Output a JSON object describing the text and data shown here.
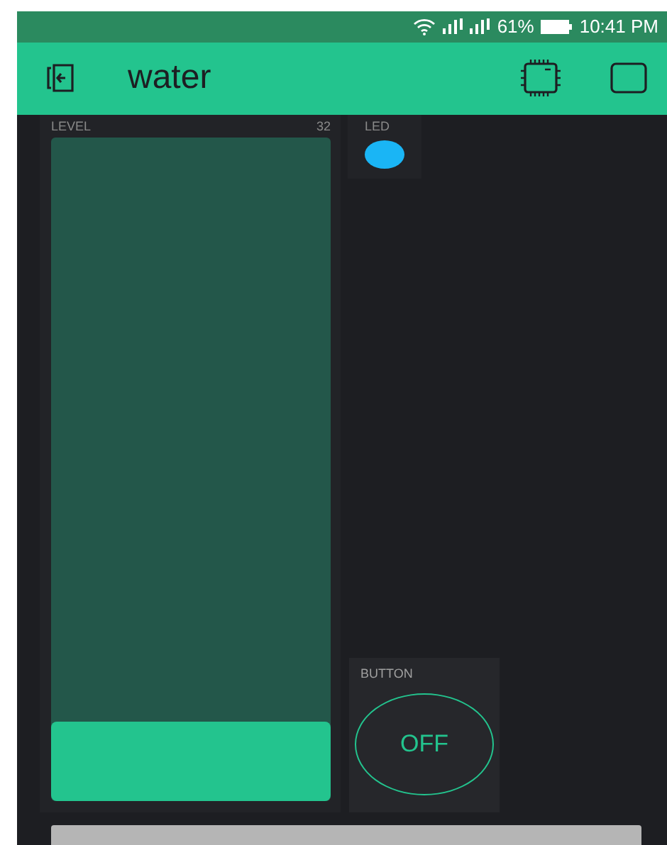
{
  "status_bar": {
    "battery_percent": "61%",
    "time": "10:41 PM"
  },
  "header": {
    "title": "water"
  },
  "level_widget": {
    "label": "LEVEL",
    "reading": "32",
    "level": 0.12
  },
  "led_widget": {
    "label": "LED",
    "on": true,
    "color": "#1ab5f5"
  },
  "button_widget": {
    "label": "BUTTON",
    "on": false,
    "text": "OFF"
  }
}
